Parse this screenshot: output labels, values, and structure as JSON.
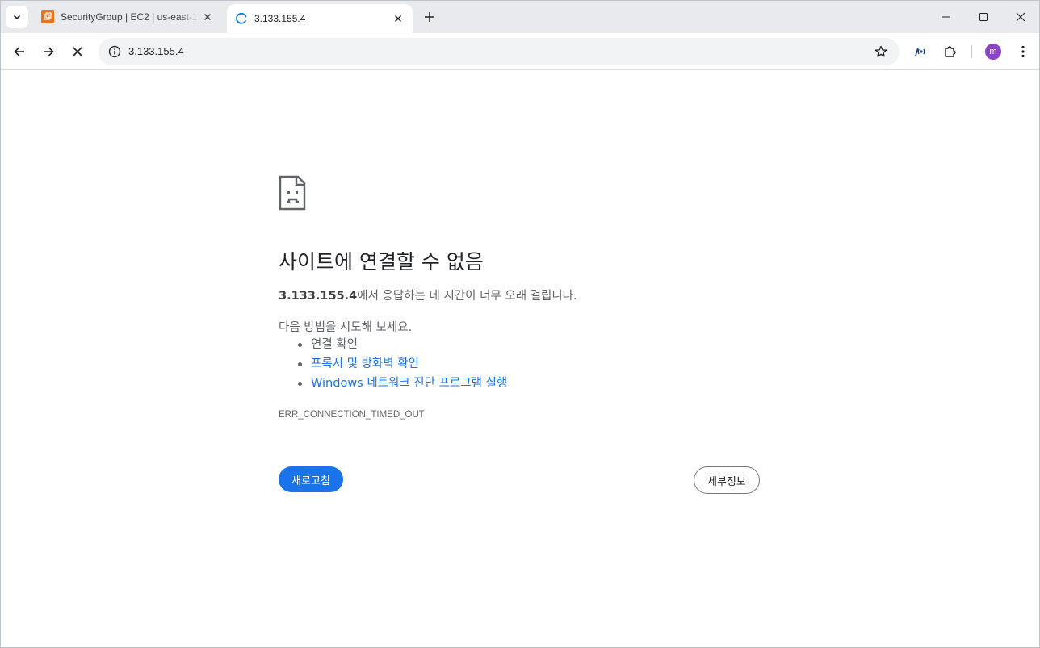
{
  "tabs": [
    {
      "title": "SecurityGroup | EC2 | us-east-1",
      "icon": "aws-ec2-icon",
      "active": false
    },
    {
      "title": "3.133.155.4",
      "icon": "loading-spinner-icon",
      "active": true
    }
  ],
  "toolbar": {
    "url": "3.133.155.4",
    "avatar_letter": "m"
  },
  "error": {
    "heading": "사이트에 연결할 수 없음",
    "host": "3.133.155.4",
    "summary_suffix": "에서 응답하는 데 시간이 너무 오래 걸립니다.",
    "suggestions_title": "다음 방법을 시도해 보세요.",
    "suggestions": [
      {
        "text": "연결 확인",
        "link": false
      },
      {
        "text": "프록시 및 방화벽 확인",
        "link": true
      },
      {
        "text": "Windows 네트워크 진단 프로그램 실행",
        "link": true
      }
    ],
    "code": "ERR_CONNECTION_TIMED_OUT",
    "reload_label": "새로고침",
    "details_label": "세부정보"
  },
  "colors": {
    "accent": "#1a73e8",
    "aws_orange": "#e8731a",
    "avatar": "#8e44c8"
  }
}
